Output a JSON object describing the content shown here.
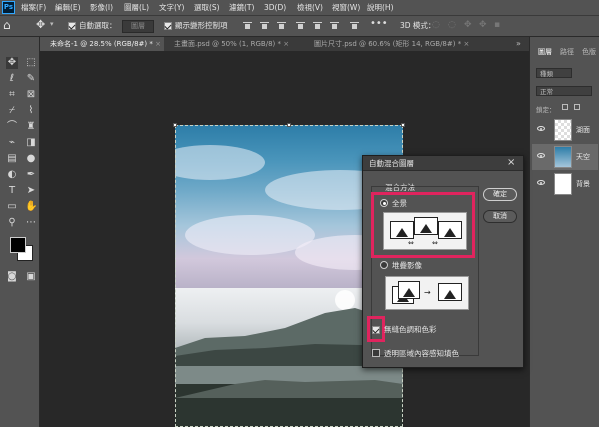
{
  "app": {
    "logo": "Ps"
  },
  "menu": [
    "檔案(F)",
    "編輯(E)",
    "影像(I)",
    "圖層(L)",
    "文字(Y)",
    "選取(S)",
    "濾鏡(T)",
    "3D(D)",
    "檢視(V)",
    "視窗(W)",
    "說明(H)"
  ],
  "options": {
    "auto_select_label": "自動選取：",
    "auto_select_value": "圖層",
    "show_transform_label": "顯示變形控制項",
    "mode_3d_label": "3D 模式："
  },
  "tabs": [
    {
      "label": "未命名-1 @ 28.5% (RGB/8#) *",
      "close": "×"
    },
    {
      "label": "主畫面.psd @ 50% (1, RGB/8) *",
      "close": "×"
    },
    {
      "label": "圖片尺寸.psd @ 60.6% (矩形 14, RGB/8#) *",
      "close": "×"
    }
  ],
  "layers_panel": {
    "tabs": [
      "圖層",
      "路徑",
      "色版"
    ],
    "kind_filter": "種類",
    "blend_mode": "正常",
    "lock_label": "鎖定：",
    "layers": [
      {
        "name": "湖面",
        "visible": true
      },
      {
        "name": "天空",
        "visible": true,
        "selected": true
      },
      {
        "name": "背景",
        "visible": true
      }
    ]
  },
  "dialog": {
    "title": "自動混合圖層",
    "close_icon": "×",
    "section_label": "混合方法",
    "option_panorama": "全景",
    "option_stack": "堆疊影像",
    "checkbox_seamless": "無縫色調和色彩",
    "checkbox_content_aware": "透明區域內容感知填色",
    "ok_button": "確定",
    "cancel_button": "取消",
    "seamless_checked": true,
    "content_aware_checked": false,
    "selected_method": "全景",
    "highlight_color": "#e0245e"
  }
}
